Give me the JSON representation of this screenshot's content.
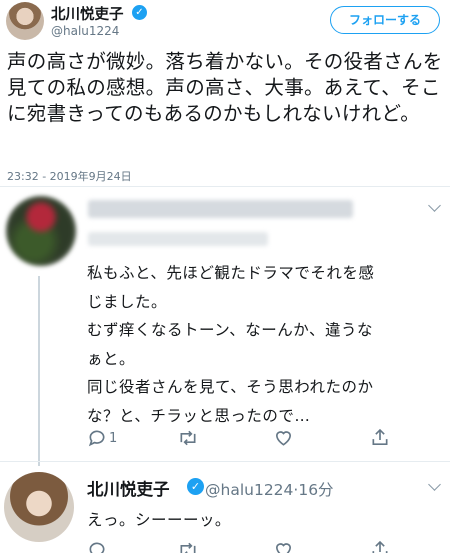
{
  "tweet": {
    "author_name": "北川悦吏子",
    "author_handle": "@halu1224",
    "follow_label": "フォローする",
    "text": "声の高さが微妙。落ち着かない。その役者さんを見ての私の感想。声の高さ、大事。あえて、そこに宛書きってのもあるのかもしれないけれど。",
    "timestamp": "23:32 - 2019年9月24日"
  },
  "reply": {
    "lines": [
      "私もふと、先ほど観たドラマでそれを感",
      "じました。",
      "むず痒くなるトーン、なーんか、違うな",
      "ぁと。",
      "同じ役者さんを見て、そう思われたのか",
      "な？と、チラッと思ったので…"
    ],
    "reply_count": "1"
  },
  "reply2": {
    "author_name": "北川悦吏子",
    "author_handle": "@halu1224",
    "time": "·16分",
    "text": "えっ。シーーーッ。"
  },
  "colors": {
    "accent": "#1da1f2",
    "text": "#14171a",
    "secondary": "#657786",
    "divider": "#e6ecf0"
  },
  "icons": [
    "verified-badge-icon",
    "chevron-down-icon",
    "reply-icon",
    "retweet-icon",
    "like-icon",
    "share-icon"
  ]
}
